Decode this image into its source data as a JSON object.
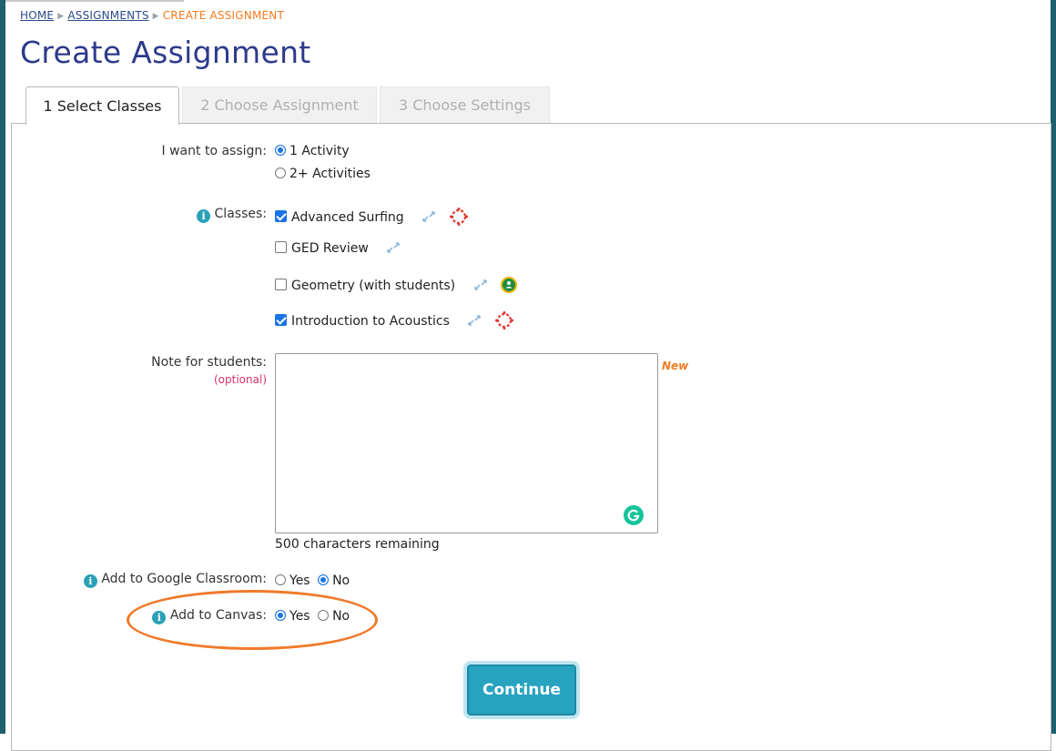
{
  "breadcrumb": {
    "home": "HOME",
    "assignments": "ASSIGNMENTS",
    "current": "CREATE ASSIGNMENT"
  },
  "page_title": "Create Assignment",
  "tabs": [
    {
      "label": "1 Select Classes",
      "state": "active"
    },
    {
      "label": "2 Choose Assignment",
      "state": "disabled"
    },
    {
      "label": "3 Choose Settings",
      "state": "disabled"
    }
  ],
  "assign": {
    "label": "I want to assign:",
    "options": [
      {
        "label": "1 Activity",
        "selected": true
      },
      {
        "label": "2+ Activities",
        "selected": false
      }
    ]
  },
  "classes": {
    "label": "Classes:",
    "items": [
      {
        "name": "Advanced Surfing",
        "checked": true,
        "integration": "canvas"
      },
      {
        "name": "GED Review",
        "checked": false,
        "integration": "none"
      },
      {
        "name": "Geometry (with students)",
        "checked": false,
        "integration": "google-classroom"
      },
      {
        "name": "Introduction to Acoustics",
        "checked": true,
        "integration": "canvas"
      }
    ]
  },
  "note": {
    "label": "Note for students:",
    "optional": "(optional)",
    "value": "",
    "new_flag": "New",
    "remaining": "500 characters remaining"
  },
  "google_classroom": {
    "label": "Add to Google Classroom:",
    "yes": "Yes",
    "no": "No",
    "selected": "No"
  },
  "canvas": {
    "label": "Add to Canvas:",
    "yes": "Yes",
    "no": "No",
    "selected": "Yes"
  },
  "continue_label": "Continue",
  "colors": {
    "title": "#2d3a8c",
    "breadcrumb_current": "#f47b20",
    "continue_button": "#27a3c0",
    "highlight_ring": "#f07a2a",
    "border": "#1f5f6e"
  }
}
